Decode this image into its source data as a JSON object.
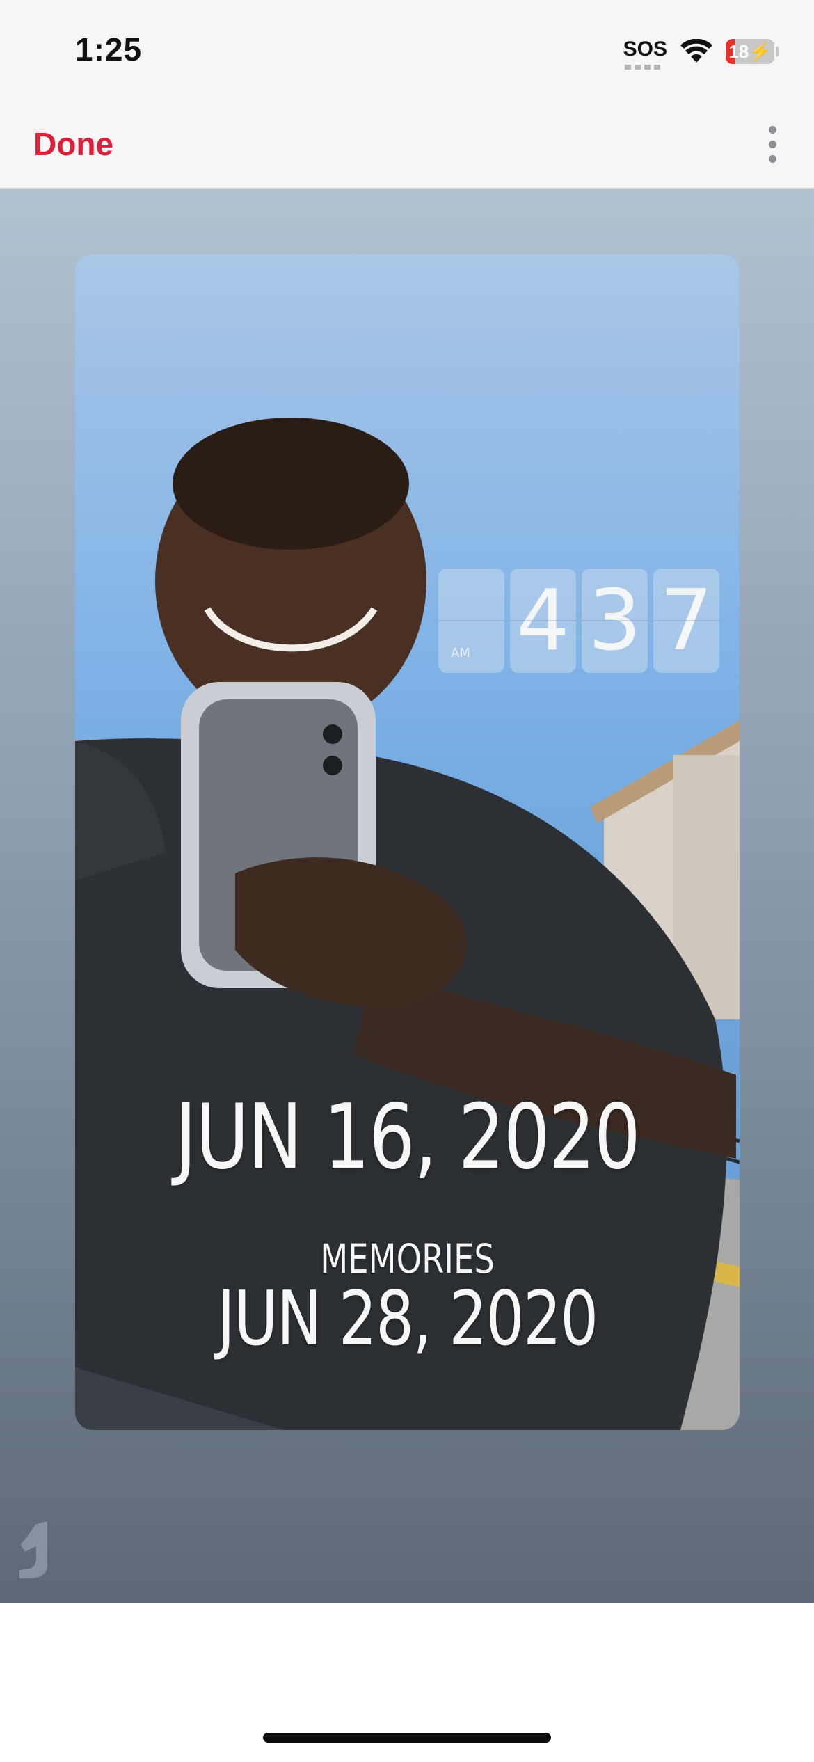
{
  "status_bar": {
    "time": "1:25",
    "sos": "SOS",
    "battery": "18"
  },
  "nav": {
    "done_label": "Done"
  },
  "photo": {
    "clock": {
      "ampm": "AM",
      "digits": [
        "4",
        "3",
        "7"
      ]
    },
    "date_main": "JUN 16, 2020",
    "memories_label": "MEMORIES",
    "memories_date": "JUN 28, 2020"
  },
  "colors": {
    "accent": "#e01e37",
    "battery_low": "#e5322b"
  },
  "icons": {
    "wifi": "wifi-icon",
    "battery": "battery-charging-icon",
    "more": "more-vertical-icon",
    "watermark": "app-logo-icon"
  }
}
